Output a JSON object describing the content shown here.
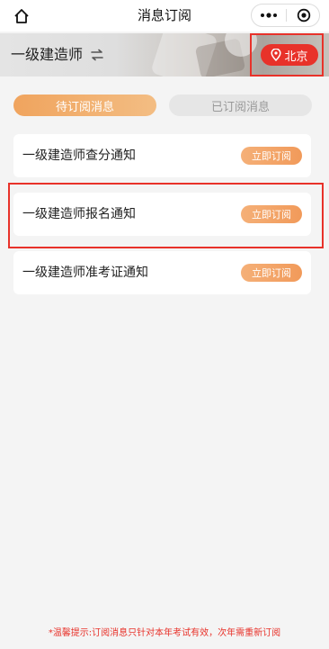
{
  "header": {
    "title": "消息订阅"
  },
  "banner": {
    "title": "一级建造师",
    "city": "北京"
  },
  "tabs": [
    {
      "label": "待订阅消息"
    },
    {
      "label": "已订阅消息"
    }
  ],
  "items": [
    {
      "title": "一级建造师查分通知",
      "button": "立即订阅"
    },
    {
      "title": "一级建造师报名通知",
      "button": "立即订阅"
    },
    {
      "title": "一级建造师准考证通知",
      "button": "立即订阅"
    }
  ],
  "footer": {
    "tip": "*温馨提示:订阅消息只针对本年考试有效，次年需重新订阅"
  },
  "colors": {
    "accent": "#f19a5a",
    "highlight": "#e8322a",
    "background": "#f4f4f4"
  },
  "icons": [
    "home-icon",
    "more-dots-icon",
    "close-target-icon",
    "swap-arrows-icon",
    "location-pin-icon"
  ]
}
